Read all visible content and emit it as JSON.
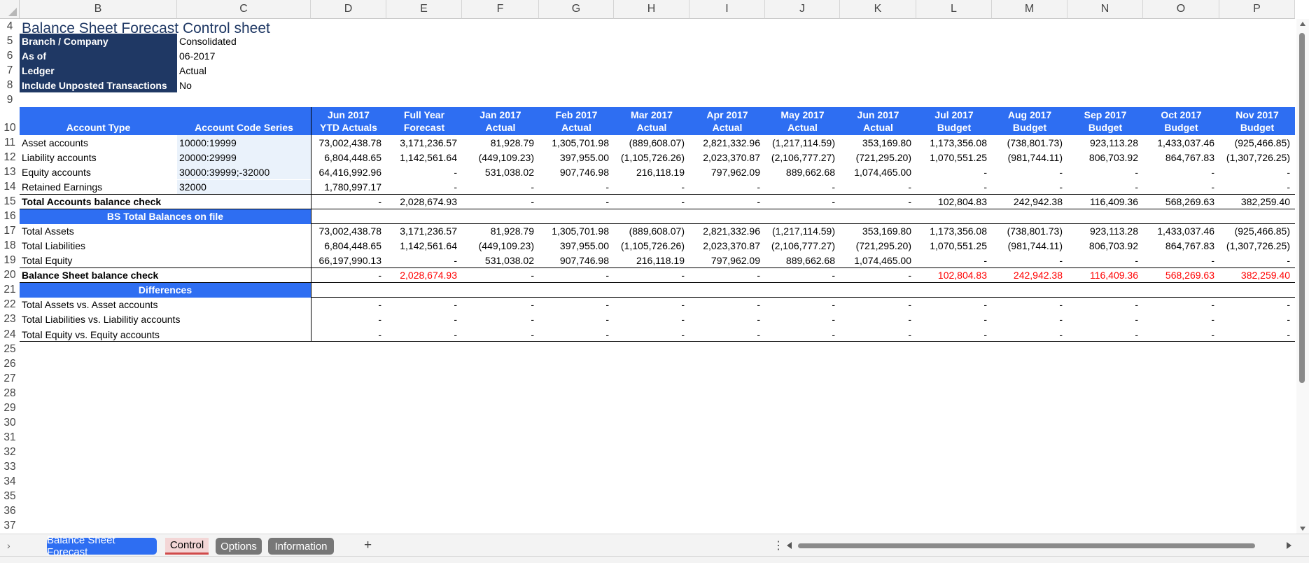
{
  "title": "Balance Sheet Forecast Control sheet",
  "col_letters": [
    "B",
    "C",
    "D",
    "E",
    "F",
    "G",
    "H",
    "I",
    "J",
    "K",
    "L",
    "M",
    "N",
    "O",
    "P"
  ],
  "row_numbers": [
    "4",
    "5",
    "6",
    "7",
    "8",
    "9",
    "10",
    "11",
    "12",
    "13",
    "14",
    "15",
    "16",
    "17",
    "18",
    "19",
    "20",
    "21",
    "22",
    "23",
    "24",
    "25",
    "26",
    "27",
    "28",
    "29",
    "30",
    "31",
    "32",
    "33",
    "34",
    "35",
    "36",
    "37"
  ],
  "params": [
    {
      "label": "Branch / Company",
      "value": "Consolidated"
    },
    {
      "label": "As of",
      "value": "06-2017"
    },
    {
      "label": "Ledger",
      "value": "Actual"
    },
    {
      "label": "Include Unposted Transactions",
      "value": "No"
    }
  ],
  "header": {
    "account_type": "Account Type",
    "account_code_series": "Account Code Series",
    "periods": [
      [
        "Jun 2017",
        "YTD Actuals"
      ],
      [
        "Full Year",
        "Forecast"
      ],
      [
        "Jan 2017",
        "Actual"
      ],
      [
        "Feb 2017",
        "Actual"
      ],
      [
        "Mar 2017",
        "Actual"
      ],
      [
        "Apr 2017",
        "Actual"
      ],
      [
        "May 2017",
        "Actual"
      ],
      [
        "Jun 2017",
        "Actual"
      ],
      [
        "Jul 2017",
        "Budget"
      ],
      [
        "Aug 2017",
        "Budget"
      ],
      [
        "Sep 2017",
        "Budget"
      ],
      [
        "Oct 2017",
        "Budget"
      ],
      [
        "Nov 2017",
        "Budget"
      ]
    ]
  },
  "accounts": [
    {
      "label": "Asset accounts",
      "code": "10000:19999",
      "values": [
        "73,002,438.78",
        "3,171,236.57",
        "81,928.79",
        "1,305,701.98",
        "(889,608.07)",
        "2,821,332.96",
        "(1,217,114.59)",
        "353,169.80",
        "1,173,356.08",
        "(738,801.73)",
        "923,113.28",
        "1,433,037.46",
        "(925,466.85)"
      ]
    },
    {
      "label": "Liability accounts",
      "code": "20000:29999",
      "values": [
        "6,804,448.65",
        "1,142,561.64",
        "(449,109.23)",
        "397,955.00",
        "(1,105,726.26)",
        "2,023,370.87",
        "(2,106,777.27)",
        "(721,295.20)",
        "1,070,551.25",
        "(981,744.11)",
        "806,703.92",
        "864,767.83",
        "(1,307,726.25)"
      ]
    },
    {
      "label": "Equity accounts",
      "code": "30000:39999;-32000",
      "values": [
        "64,416,992.96",
        "-",
        "531,038.02",
        "907,746.98",
        "216,118.19",
        "797,962.09",
        "889,662.68",
        "1,074,465.00",
        "-",
        "-",
        "-",
        "-",
        "-"
      ]
    },
    {
      "label": "Retained Earnings",
      "code": "32000",
      "values": [
        "1,780,997.17",
        "-",
        "-",
        "-",
        "-",
        "-",
        "-",
        "-",
        "-",
        "-",
        "-",
        "-",
        "-"
      ]
    }
  ],
  "accounts_check": {
    "label": "Total Accounts balance check",
    "values": [
      "-",
      "2,028,674.93",
      "-",
      "-",
      "-",
      "-",
      "-",
      "-",
      "102,804.83",
      "242,942.38",
      "116,409.36",
      "568,269.63",
      "382,259.40"
    ]
  },
  "bs_section": "BS Total Balances on file",
  "bs_rows": [
    {
      "label": "Total Assets",
      "values": [
        "73,002,438.78",
        "3,171,236.57",
        "81,928.79",
        "1,305,701.98",
        "(889,608.07)",
        "2,821,332.96",
        "(1,217,114.59)",
        "353,169.80",
        "1,173,356.08",
        "(738,801.73)",
        "923,113.28",
        "1,433,037.46",
        "(925,466.85)"
      ]
    },
    {
      "label": "Total Liabilities",
      "values": [
        "6,804,448.65",
        "1,142,561.64",
        "(449,109.23)",
        "397,955.00",
        "(1,105,726.26)",
        "2,023,370.87",
        "(2,106,777.27)",
        "(721,295.20)",
        "1,070,551.25",
        "(981,744.11)",
        "806,703.92",
        "864,767.83",
        "(1,307,726.25)"
      ]
    },
    {
      "label": "Total Equity",
      "values": [
        "66,197,990.13",
        "-",
        "531,038.02",
        "907,746.98",
        "216,118.19",
        "797,962.09",
        "889,662.68",
        "1,074,465.00",
        "-",
        "-",
        "-",
        "-",
        "-"
      ]
    }
  ],
  "bs_check": {
    "label": "Balance Sheet balance check",
    "values": [
      "-",
      "2,028,674.93",
      "-",
      "-",
      "-",
      "-",
      "-",
      "-",
      "102,804.83",
      "242,942.38",
      "116,409.36",
      "568,269.63",
      "382,259.40"
    ],
    "red_columns": [
      1,
      8,
      9,
      10,
      11,
      12
    ]
  },
  "diff_section": "Differences",
  "diff_rows": [
    {
      "label": "Total Assets vs. Asset accounts",
      "values": [
        "-",
        "-",
        "-",
        "-",
        "-",
        "-",
        "-",
        "-",
        "-",
        "-",
        "-",
        "-",
        "-"
      ]
    },
    {
      "label": "Total Liabilities vs. Liabilitiy accounts",
      "values": [
        "-",
        "-",
        "-",
        "-",
        "-",
        "-",
        "-",
        "-",
        "-",
        "-",
        "-",
        "-",
        "-"
      ]
    },
    {
      "label": "Total Equity vs. Equity accounts",
      "values": [
        "-",
        "-",
        "-",
        "-",
        "-",
        "-",
        "-",
        "-",
        "-",
        "-",
        "-",
        "-",
        "-"
      ]
    }
  ],
  "tabs": [
    "Balance Sheet Forecast",
    "Control",
    "Options",
    "Information"
  ],
  "active_tab": "Control",
  "colors": {
    "dark_label": "#1f3864",
    "header_blue": "#2e6ef2",
    "tab_blue": "#2e6ef2",
    "tab_gray": "#777777",
    "negative_check": "#ff0000"
  }
}
